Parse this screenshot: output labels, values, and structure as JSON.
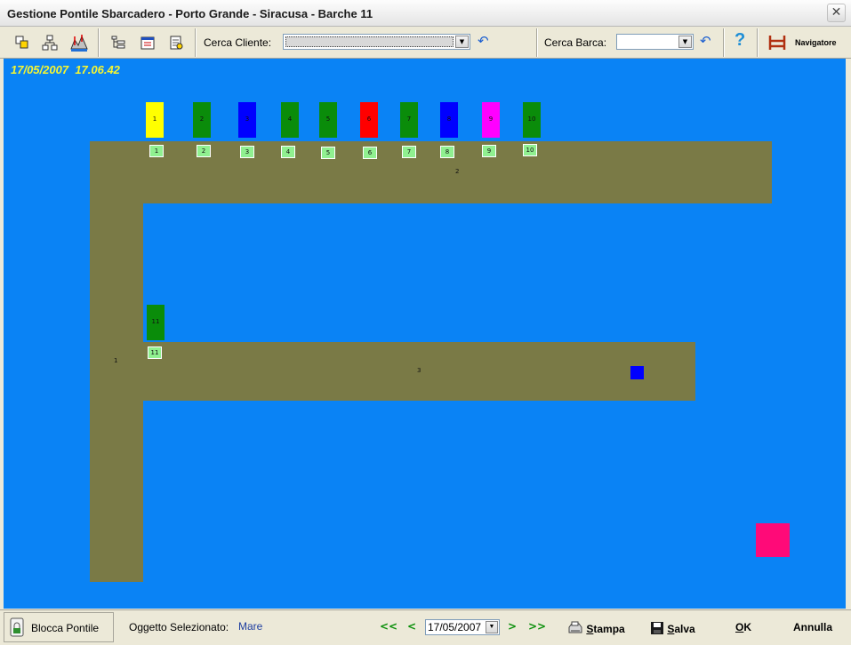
{
  "window": {
    "title": "Gestione Pontile Sbarcadero - Porto Grande - Siracusa - Barche 11"
  },
  "toolbar": {
    "cerca_cliente_label": "Cerca Cliente:",
    "cerca_cliente_value": "",
    "cerca_barca_label": "Cerca Barca:",
    "cerca_barca_value": "",
    "navigatore_label": "Navigatore",
    "help_glyph": "?"
  },
  "canvas": {
    "background_color": "#0a83f5",
    "date": "17/05/2007",
    "time": "17.06.42",
    "piers": [
      {
        "label": "2"
      },
      {
        "label": "1"
      },
      {
        "label": "3"
      }
    ],
    "boats": [
      {
        "label": "1",
        "color": "#ffff00"
      },
      {
        "label": "2",
        "color": "#0a8c0a"
      },
      {
        "label": "3",
        "color": "#0000ff"
      },
      {
        "label": "4",
        "color": "#0a8c0a"
      },
      {
        "label": "5",
        "color": "#0a8c0a"
      },
      {
        "label": "6",
        "color": "#ff0000"
      },
      {
        "label": "7",
        "color": "#0a8c0a"
      },
      {
        "label": "8",
        "color": "#0000ff"
      },
      {
        "label": "9",
        "color": "#ff00ff"
      },
      {
        "label": "10",
        "color": "#0a8c0a"
      },
      {
        "label": "11",
        "color": "#0a8c0a"
      }
    ],
    "slots": [
      "1",
      "2",
      "3",
      "4",
      "5",
      "6",
      "7",
      "8",
      "9",
      "10",
      "11"
    ],
    "markers": [
      {
        "color": "#0000ff"
      },
      {
        "color": "#ff0a78"
      }
    ]
  },
  "statusbar": {
    "blocca_label": "Blocca Pontile",
    "oggetto_label": "Oggetto Selezionato:",
    "oggetto_value": "Mare",
    "nav_first": "<<",
    "nav_prev": "<",
    "date_value": "17/05/2007",
    "nav_next": ">",
    "nav_last": ">>",
    "stampa_underlined": "S",
    "stampa_rest": "tampa",
    "salva_underlined": "S",
    "salva_rest": "alva",
    "ok_underlined": "O",
    "ok_rest": "K",
    "annulla_label": "Annulla"
  }
}
